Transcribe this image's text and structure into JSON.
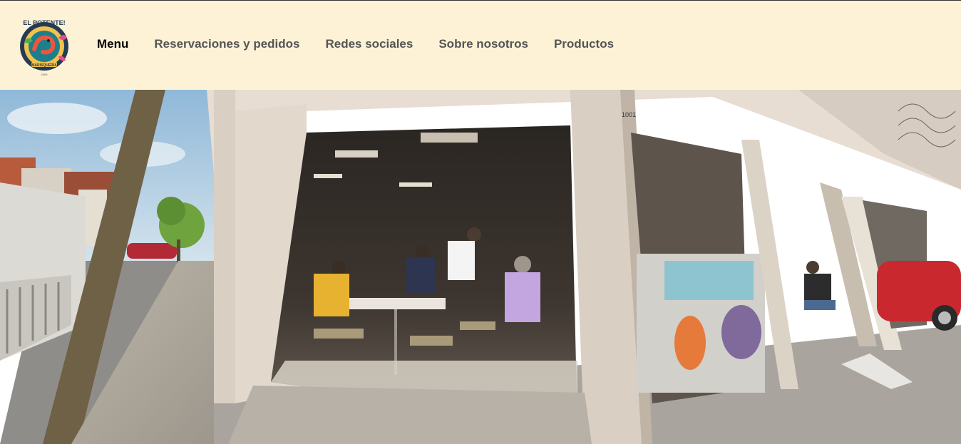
{
  "brand": {
    "logo_text": "EL POTENTE!",
    "logo_subtext": "MARISQUERÍA",
    "logo_year": "2009"
  },
  "nav": {
    "items": [
      {
        "label": "Menu",
        "active": true
      },
      {
        "label": "Reservaciones y pedidos",
        "active": false
      },
      {
        "label": "Redes sociales",
        "active": false
      },
      {
        "label": "Sobre nosotros",
        "active": false
      },
      {
        "label": "Productos",
        "active": false
      }
    ]
  },
  "hero": {
    "building_number": "1001"
  },
  "colors": {
    "header_bg": "#fdf2d6",
    "active_link": "#000000",
    "link": "#555555"
  }
}
